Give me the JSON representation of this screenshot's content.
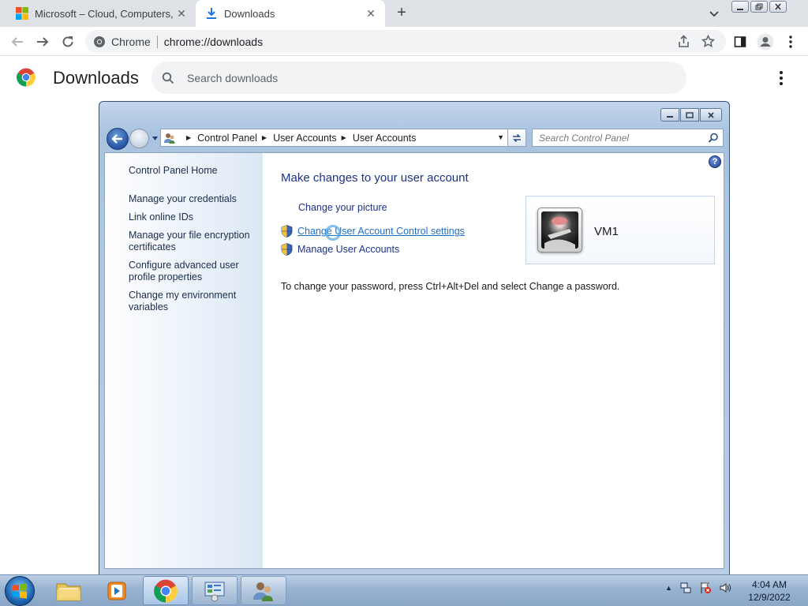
{
  "browser": {
    "tabs": [
      {
        "title": "Microsoft – Cloud, Computers, Ap",
        "icon": "microsoft-logo-icon",
        "active": false
      },
      {
        "title": "Downloads",
        "icon": "download-icon",
        "active": true
      }
    ],
    "omnibox": {
      "site_label": "Chrome",
      "url": "chrome://downloads"
    }
  },
  "downloads_page": {
    "title": "Downloads",
    "search_placeholder": "Search downloads"
  },
  "control_panel": {
    "breadcrumb": [
      "Control Panel",
      "User Accounts",
      "User Accounts"
    ],
    "search_placeholder": "Search Control Panel",
    "sidebar": {
      "home": "Control Panel Home",
      "items": [
        "Manage your credentials",
        "Link online IDs",
        "Manage your file encryption certificates",
        "Configure advanced user profile properties",
        "Change my environment variables"
      ]
    },
    "heading": "Make changes to your user account",
    "links": [
      {
        "label": "Change your picture",
        "shield": false
      },
      {
        "label": "Change User Account Control settings",
        "shield": true
      },
      {
        "label": "Manage User Accounts",
        "shield": true
      }
    ],
    "note": "To change your password, press Ctrl+Alt+Del and select Change a password.",
    "user_name": "VM1",
    "help_glyph": "?"
  },
  "taskbar": {
    "items": [
      "folder-icon",
      "media-player-icon",
      "chrome-icon",
      "control-panel-icon",
      "user-accounts-icon"
    ],
    "clock_time": "4:04 AM",
    "clock_date": "12/9/2022"
  },
  "colors": {
    "link": "#1e3287",
    "link_hover": "#1f6fc5",
    "chrome_tabstrip": "#dee1e6"
  }
}
